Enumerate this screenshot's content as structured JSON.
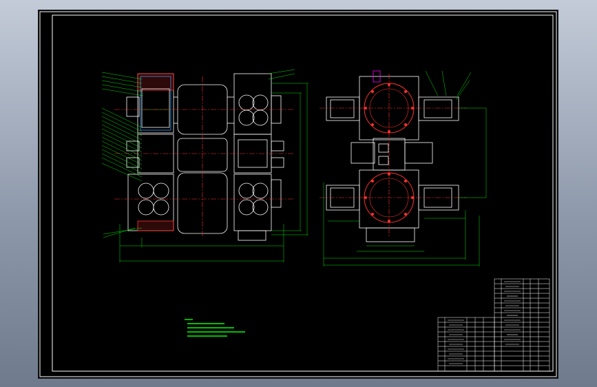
{
  "app": {
    "background_color": "#8e99ab",
    "canvas_color": "#000000"
  },
  "colors": {
    "frame": "#ffffff",
    "geometry": "#ffffff",
    "dimension": "#00ff00",
    "centerline": "#ff3030",
    "section_fill": "#ff3030",
    "leader_magenta": "#ff00ff",
    "hatch": "#ffffff",
    "seal_blue": "#3aa0ff",
    "tech_text": "#00ff00"
  },
  "drawing": {
    "title": "",
    "views": [
      "front-section-view",
      "plan-view"
    ],
    "technical_requirements_lines": 5,
    "parts_list_rows": 18,
    "title_block_rows": 10
  }
}
